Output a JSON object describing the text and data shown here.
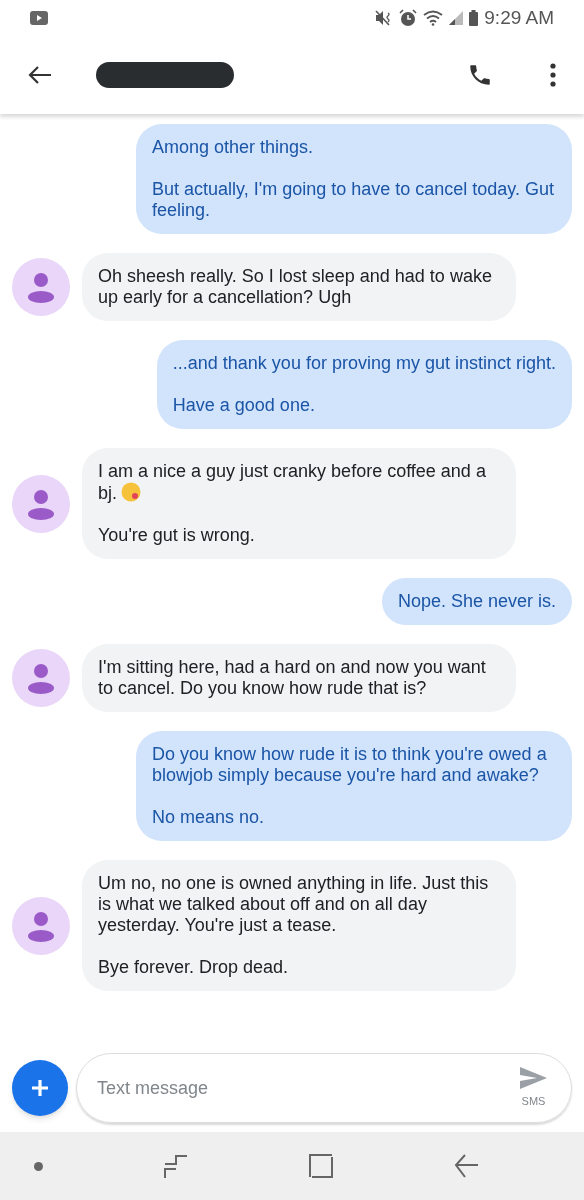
{
  "status_bar": {
    "time": "9:29 AM"
  },
  "messages": [
    {
      "kind": "sent",
      "paragraphs": [
        "Among other things.",
        "But actually, I'm going to have to cancel today. Gut feeling."
      ]
    },
    {
      "kind": "received",
      "paragraphs": [
        "Oh sheesh really. So I lost sleep and had to wake up early for a cancellation? Ugh"
      ]
    },
    {
      "kind": "sent",
      "paragraphs": [
        "...and thank you for proving my gut instinct right.",
        "Have a good one."
      ]
    },
    {
      "kind": "received",
      "paragraphs": [
        "I am a nice a guy just cranky before coffee and a bj.",
        "You're gut is wrong."
      ],
      "emoji_after_first": true
    },
    {
      "kind": "sent",
      "paragraphs": [
        "Nope. She never is."
      ]
    },
    {
      "kind": "received",
      "paragraphs": [
        "I'm sitting here, had a hard on and now you want to cancel. Do you know how rude that is?"
      ]
    },
    {
      "kind": "sent",
      "paragraphs": [
        "Do you know how rude it is to think you're owed a blowjob simply because you're hard and awake?",
        "No means no."
      ]
    },
    {
      "kind": "received",
      "paragraphs": [
        "Um no, no one is owned anything in life. Just this is what we talked about off and on all day yesterday. You're just a tease.",
        "Bye forever. Drop dead."
      ]
    }
  ],
  "composer": {
    "placeholder": "Text message",
    "send_label": "SMS"
  }
}
